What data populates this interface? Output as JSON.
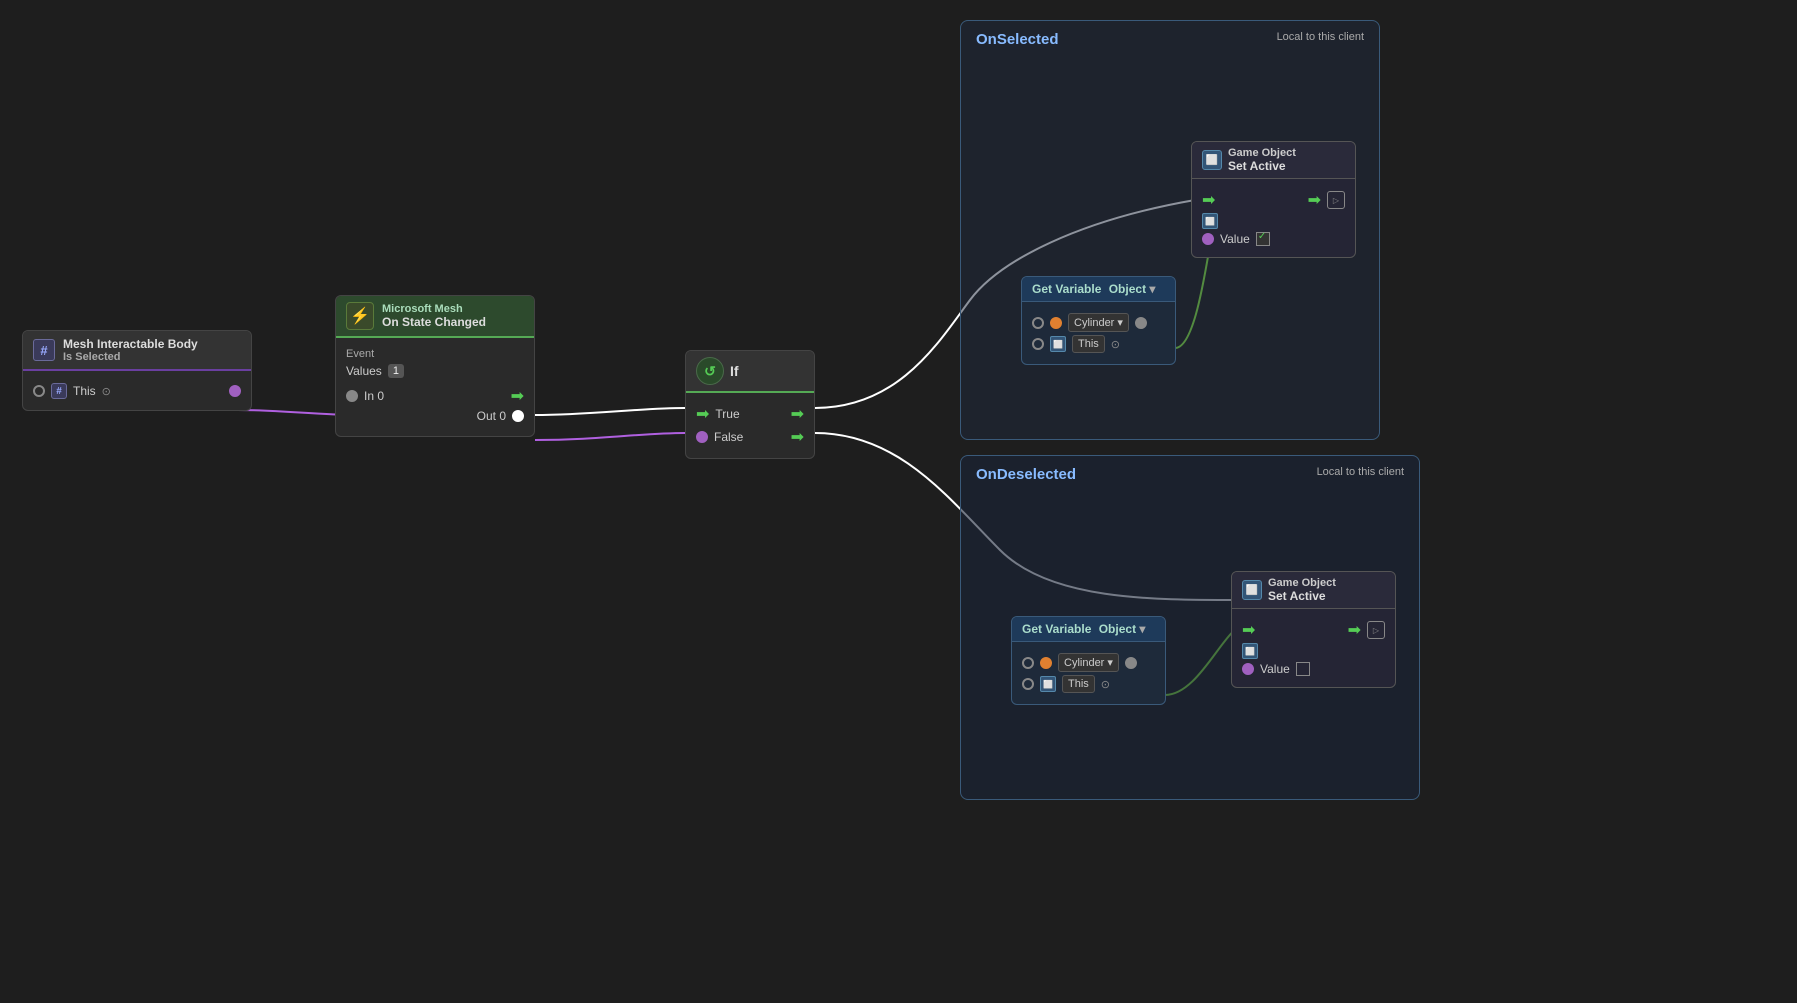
{
  "canvas": {
    "background": "#1e1e1e"
  },
  "nodes": {
    "mesh_interactable": {
      "title": "Mesh Interactable Body",
      "subtitle": "Is Selected",
      "port_label": "This"
    },
    "on_state_changed": {
      "provider": "Microsoft Mesh",
      "title": "On State Changed",
      "event_label": "Event",
      "values_label": "Values",
      "values_count": "1",
      "port_in": "In 0",
      "port_out": "Out 0"
    },
    "if_node": {
      "title": "If",
      "port_true": "True",
      "port_false": "False"
    },
    "get_var_1": {
      "title": "Get Variable",
      "subtitle": "Object",
      "dropdown1": "Cylinder",
      "dropdown2": "This"
    },
    "get_var_2": {
      "title": "Get Variable",
      "subtitle": "Object",
      "dropdown1": "Cylinder",
      "dropdown2": "This"
    },
    "set_active_1": {
      "title": "Game Object",
      "subtitle": "Set Active",
      "local_badge": "Local to this client",
      "value_label": "Value",
      "value_checked": true
    },
    "set_active_2": {
      "title": "Game Object",
      "subtitle": "Set Active",
      "local_badge": "Local to this client",
      "value_label": "Value",
      "value_checked": false
    }
  },
  "containers": {
    "on_selected": {
      "label": "OnSelected"
    },
    "on_deselected": {
      "label": "OnDeselected"
    }
  }
}
